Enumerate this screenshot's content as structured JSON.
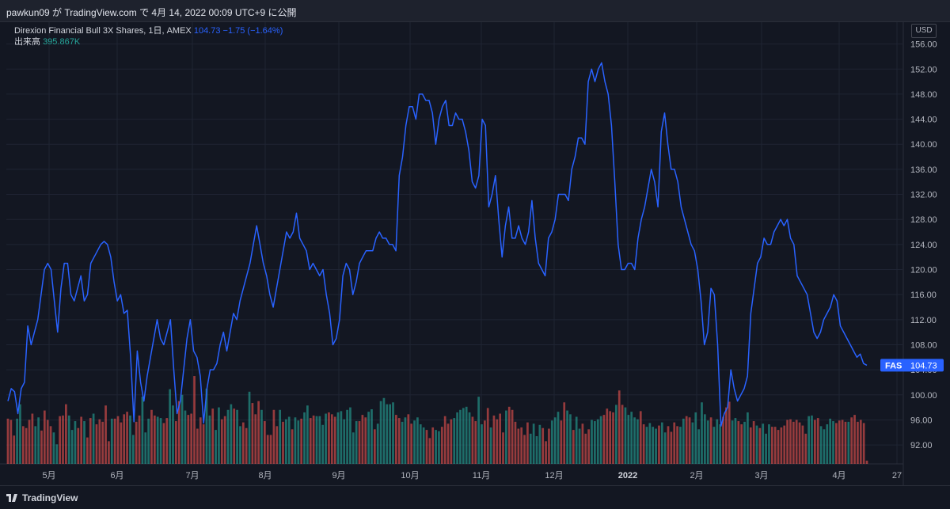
{
  "header": {
    "publish_text": "pawkun09 が TradingView.com で 4月 14, 2022 00:09 UTC+9 に公開"
  },
  "legend": {
    "symbol_text": "Direxion Financial Bull 3X Shares, 1日, AMEX",
    "quote": "104.73  −1.75 (−1.64%)",
    "volume_label": "出来高",
    "volume_value": "395.867K"
  },
  "currency_button": "USD",
  "price_tag": {
    "symbol": "FAS",
    "value": "104.73"
  },
  "footer": {
    "brand": "TradingView"
  },
  "colors": {
    "line": "#2962ff",
    "vol_up": "#26a69a",
    "vol_down": "#ef5350",
    "bg": "#131722"
  },
  "chart_data": {
    "type": "line",
    "title": "Direxion Financial Bull 3X Shares, 1日, AMEX",
    "ylabel": "",
    "xlabel": "",
    "ylim": [
      88.5,
      157.5
    ],
    "y_ticks": [
      "156.00",
      "152.00",
      "148.00",
      "144.00",
      "140.00",
      "136.00",
      "132.00",
      "128.00",
      "124.00",
      "120.00",
      "116.00",
      "112.00",
      "108.00",
      "104.00",
      "100.00",
      "96.00",
      "92.00"
    ],
    "x_ticks": [
      "5月",
      "6月",
      "7月",
      "8月",
      "9月",
      "10月",
      "11月",
      "12月",
      "2022",
      "2月",
      "3月",
      "4月",
      "27"
    ],
    "grid": true,
    "series": [
      {
        "values": [
          99,
          101,
          100.5,
          97,
          101,
          102,
          111,
          108,
          110,
          112,
          116,
          120,
          121,
          120,
          115,
          110,
          117,
          121,
          121,
          116,
          115,
          117,
          119,
          115,
          116,
          121,
          122,
          123,
          124,
          124.5,
          124,
          122,
          118,
          115,
          116,
          113,
          113.5,
          106,
          95.7,
          107,
          102,
          99,
          103,
          106,
          109,
          112,
          109,
          108,
          110,
          112,
          104,
          97,
          99,
          104,
          109,
          112,
          107,
          106,
          103,
          95.5,
          101,
          104,
          104,
          105,
          108,
          110,
          107,
          110,
          113,
          112,
          115,
          117,
          119,
          121,
          124,
          127,
          124,
          121,
          119,
          116,
          114,
          117,
          120,
          123,
          126,
          125,
          126,
          129,
          125,
          124,
          123,
          120,
          121,
          120,
          119,
          120,
          116,
          113,
          108,
          109,
          112,
          119,
          121,
          120,
          116,
          118,
          121,
          122,
          123,
          123,
          123,
          125,
          126,
          125,
          125,
          124,
          124,
          123,
          135,
          138,
          143,
          146,
          146,
          144,
          148,
          148,
          147,
          147,
          145,
          140,
          144,
          146,
          147,
          143,
          143,
          145,
          144,
          144,
          142,
          139,
          134,
          133,
          135,
          144,
          143,
          130,
          132,
          135,
          128,
          122,
          127,
          130,
          125,
          125,
          127,
          125,
          124,
          126,
          131,
          125,
          121,
          120,
          119,
          125,
          126,
          128,
          132,
          132,
          132,
          131,
          136,
          138,
          141,
          141,
          140,
          150,
          152,
          150,
          152,
          153,
          150,
          148,
          143,
          134,
          124,
          120,
          120,
          121,
          121,
          120,
          125,
          128,
          130,
          133,
          136,
          134,
          130,
          142,
          145,
          140,
          136,
          136,
          134,
          130,
          128,
          126,
          124,
          123,
          120,
          115,
          108,
          110,
          117,
          116,
          108,
          95,
          97,
          98,
          104,
          101,
          99,
          100,
          101,
          103,
          113,
          117,
          121,
          122,
          125,
          124,
          124,
          126,
          127,
          128,
          127,
          128,
          125,
          124,
          119,
          118,
          117,
          116,
          113,
          110,
          109,
          110,
          112,
          113,
          114,
          116,
          115,
          111,
          110,
          109,
          108,
          107,
          106,
          106.5,
          105,
          104.73
        ]
      }
    ],
    "volume": {
      "label": "出来高",
      "values": [
        96.2,
        96,
        93.5,
        96.2,
        98.5,
        95,
        94.7,
        96,
        97,
        95,
        96.4,
        94.3,
        97.5,
        96,
        95,
        94,
        92.1,
        96.6,
        96.7,
        98.5,
        96.7,
        94.4,
        95.8,
        94.7,
        96.5,
        95.8,
        93.2,
        96.3,
        97,
        95.3,
        96.1,
        95.7,
        98.3,
        92.6,
        96.2,
        96.2,
        96.6,
        95.6,
        96.9,
        97.3,
        96.7,
        93.6,
        95.7,
        96.7,
        99.7,
        94,
        96.2,
        97.6,
        96.7,
        96.5,
        96.3,
        95.5,
        96.3,
        100.9,
        98.3,
        95.8,
        99,
        100,
        97.5,
        96.8,
        97,
        103,
        94.6,
        96.4,
        95.3,
        101,
        96.7,
        97.8,
        94.4,
        98,
        96.1,
        96.6,
        97.6,
        98.5,
        97.8,
        97.6,
        95,
        95.6,
        94.7,
        100.5,
        98.7,
        96.9,
        99,
        97.6,
        95.8,
        93.6,
        93.6,
        97.6,
        95,
        97.6,
        95.7,
        96.1,
        96.5,
        94.5,
        96.4,
        95.9,
        96.2,
        97.2,
        98.3,
        96.3,
        96.7,
        96.6,
        96.6,
        95.2,
        97,
        97.2,
        96.9,
        96.5,
        97.2,
        97.4,
        96.1,
        97.6,
        98,
        94,
        95.8,
        95.8,
        96.8,
        96.4,
        97.3,
        97.7,
        94.5,
        95.4,
        99,
        99.5,
        98.5,
        98.5,
        98.8,
        96.8,
        96.3,
        95.7,
        96.4,
        96.9,
        95.4,
        95.9,
        96.4,
        95.3,
        94.8,
        94.4,
        93.1,
        94.8,
        94.4,
        94.2,
        94.9,
        96.6,
        95.4,
        96.1,
        96.3,
        97.2,
        97.6,
        97.9,
        98.1,
        97.2,
        96.5,
        95.8,
        99.7,
        95.3,
        95.9,
        97.9,
        94.8,
        96.7,
        96.1,
        97,
        94,
        97.5,
        98.1,
        97.6,
        95.7,
        94.6,
        94.8,
        93.6,
        95.6,
        93.8,
        95.4,
        93.4,
        95.2,
        94.7,
        92.6,
        94.6,
        95.9,
        96.4,
        97.3,
        95.9,
        98.8,
        97.5,
        96.9,
        94.4,
        96.5,
        94.6,
        95.4,
        93.8,
        94.5,
        96,
        95.8,
        96.1,
        96.6,
        96.8,
        97.8,
        97.4,
        97.2,
        98.4,
        100.7,
        98.4,
        98,
        96.8,
        97.3,
        96.4,
        96.1,
        97.4,
        95.3,
        94.9,
        95.5,
        94.9,
        94.6,
        95.1,
        95.6,
        94,
        95,
        94.1,
        95.6,
        95,
        94.9,
        96.2,
        96.6,
        96.4,
        95.6,
        97.2,
        94.5,
        98.8,
        96.9,
        95.9,
        96.4,
        94.9,
        96.1,
        95.3,
        96.5,
        98,
        98.9,
        95.9,
        96.3,
        95.8,
        95.3,
        95.7,
        97.2,
        94.8,
        95.8,
        95.1,
        94.7,
        95.4,
        93.8,
        95.3,
        94.9,
        94.9,
        94.4,
        94.8,
        95.1,
        96,
        96.1,
        95.7,
        96,
        95.6,
        95.1,
        93.8,
        96.6,
        96.7,
        96,
        96.3,
        95,
        94.5,
        95.3,
        96.2,
        95.8,
        95.5,
        95.9,
        96,
        95.7,
        95.7,
        96.4,
        96.8,
        95.7,
        96,
        95.5,
        89.5
      ],
      "colors": "ddduudddduudddduuddduuuddudduddddduddddduudduuudduudduudduudddddduuduudduuduudduddduddddduduuduuduudduuuuddduuuuuuuddduuduuuuuudduudduuuuddduudddduuuuuudduuddudddduddddddduuuuddduuudduuduuddduuuuddddudduuuuudduuuuduudddduudduuuuuuduuuddduudduudduduuudddddddddddduudduuuuuddddudddddddddu"
    }
  }
}
